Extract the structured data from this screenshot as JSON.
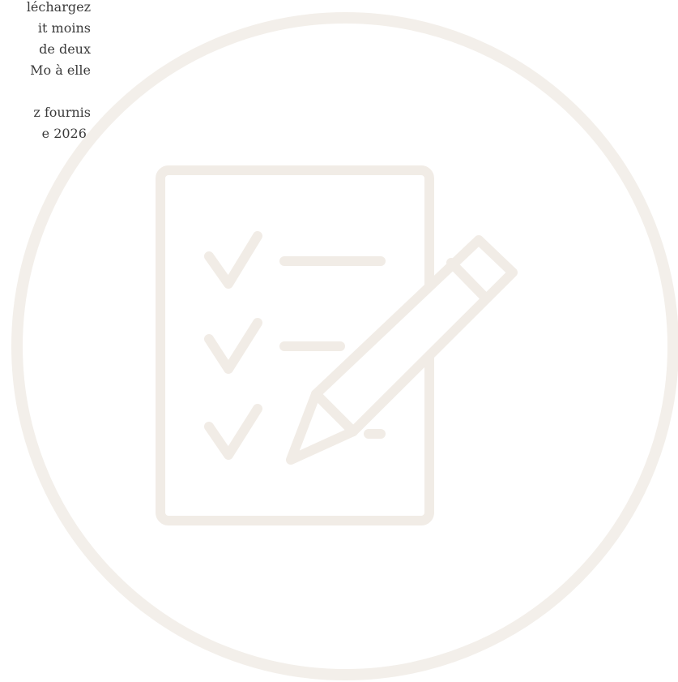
{
  "text": {
    "lines_a": [
      "léchargez",
      "it moins",
      "de deux",
      "Mo à elle"
    ],
    "lines_b": [
      "z fournis",
      "e 2026."
    ]
  },
  "illustration": {
    "icon": "checklist-with-pencil-icon",
    "circle_color": "#f3efea",
    "stroke_color": "#f1ece6"
  }
}
